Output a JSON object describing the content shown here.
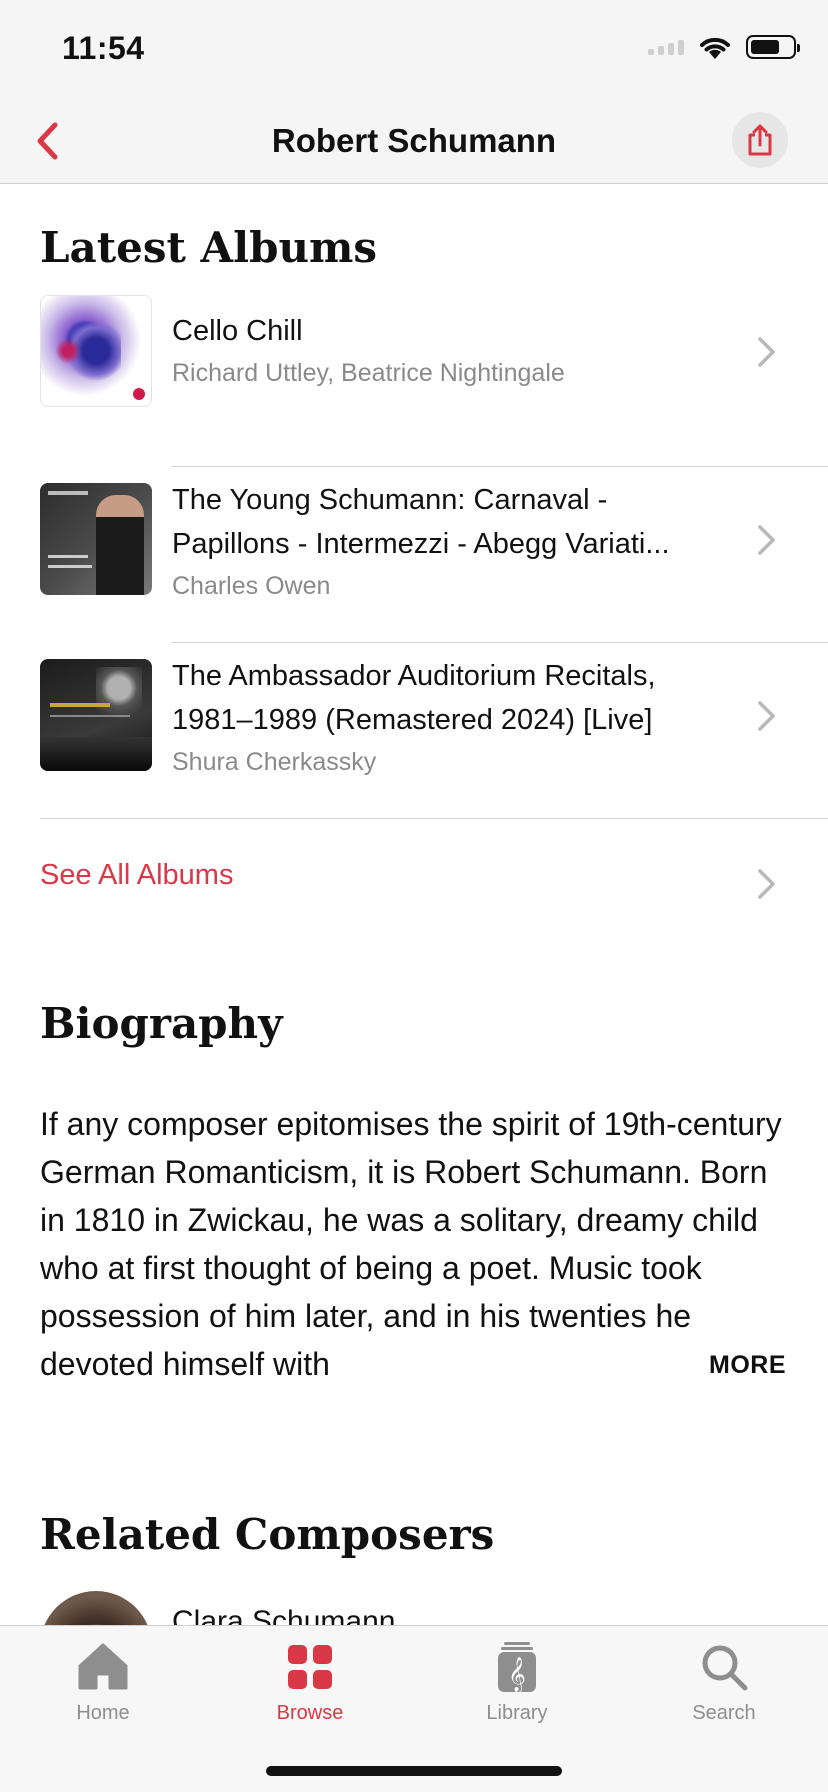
{
  "status": {
    "time": "11:54"
  },
  "nav": {
    "title": "Robert Schumann"
  },
  "latest_albums": {
    "heading": "Latest Albums",
    "items": [
      {
        "title_line1": "Cello Chill",
        "title_line2": "",
        "artist": "Richard Uttley, Beatrice Nightingale"
      },
      {
        "title_line1": "The Young Schumann: Carnaval -",
        "title_line2": "Papillons - Intermezzi - Abegg Variati...",
        "artist": "Charles Owen"
      },
      {
        "title_line1": "The Ambassador Auditorium Recitals,",
        "title_line2": "1981–1989 (Remastered 2024) [Live]",
        "artist": "Shura Cherkassky"
      }
    ],
    "see_all": "See All Albums"
  },
  "biography": {
    "heading": "Biography",
    "text": "If any composer epitomises the spirit of 19th-century German Romanticism, it is Robert Schumann. Born in 1810 in Zwickau, he was a solitary, dreamy child who at first thought of being a poet. Music took possession of him later, and in his twenties he devoted himself with",
    "more": "MORE"
  },
  "related": {
    "heading": "Related Composers",
    "first_name": "Clara Schumann"
  },
  "tabs": [
    {
      "label": "Home",
      "icon": "home-icon",
      "active": false
    },
    {
      "label": "Browse",
      "icon": "browse-grid-icon",
      "active": true
    },
    {
      "label": "Library",
      "icon": "library-music-icon",
      "active": false
    },
    {
      "label": "Search",
      "icon": "search-icon",
      "active": false
    }
  ],
  "colors": {
    "accent": "#d93846",
    "secondary_text": "#8a8a8a",
    "icon_gray": "#8e8e8e"
  }
}
